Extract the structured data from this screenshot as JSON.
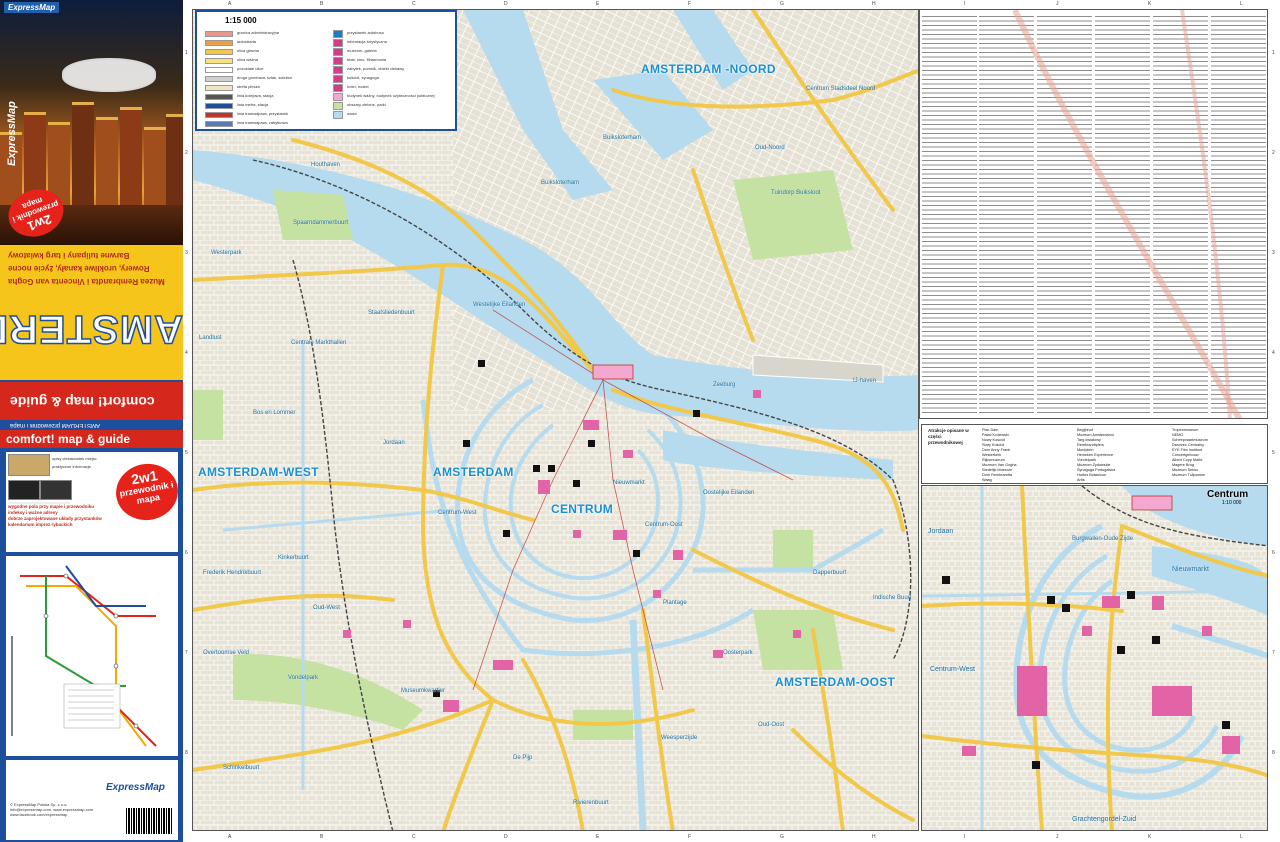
{
  "cover": {
    "brand": "ExpressMap",
    "title": "AMSTERDAM",
    "tagline": "comfort! map & guide",
    "subtitle": "AMSTERDAM   przewodnik i mapa",
    "bullets": [
      "Muzea Rembrandta i Vincenta van Gogha",
      "Rowery, urokliwe kanały, życie nocne",
      "Barwne tulipany i targ kwiatowy"
    ],
    "badge_main": "2w1",
    "badge_sub": "przewodnik i mapa",
    "features": [
      "opisy ciekawostek miejsc",
      "praktyczne informacje",
      "wygodne pola przy mapie i przewodniku",
      "indeksy i ważne adresy",
      "dobrze zaprojektowane układy przystanków",
      "kalendarium imprez rybackich"
    ],
    "publisher_lines": [
      "© ExpressMap Polska Sp. z o.o.",
      "info@expressmap.com, www.expressmap.com",
      "www.facebook.com/expressmap"
    ],
    "barcode": "9788375468"
  },
  "map": {
    "scale": "1:15 000",
    "grid_columns": [
      "A",
      "B",
      "C",
      "D",
      "E",
      "F",
      "G",
      "H",
      "I",
      "J",
      "K",
      "L"
    ],
    "grid_rows": [
      "1",
      "2",
      "3",
      "4",
      "5",
      "6",
      "7",
      "8"
    ],
    "districts": [
      {
        "label": "AMSTERDAM -NOORD"
      },
      {
        "label": "AMSTERDAM-WEST"
      },
      {
        "label": "AMSTERDAM"
      },
      {
        "label": "CENTRUM"
      },
      {
        "label": "AMSTERDAM-OOST"
      }
    ],
    "places": [
      "Buiksloterham",
      "Centrum Stadsdeel Noord",
      "Buiksloterham",
      "Oud-Noord",
      "Tuindorp Buiksloot",
      "Houthaven",
      "Spaarndammerbuurt",
      "Westerpark",
      "Staatsliedenbuurt",
      "Centrale Markthallen",
      "Landlust",
      "Bos en Lommer",
      "Centrum-West",
      "Centrum-Oost",
      "Kinkerbuurt",
      "Oud-West",
      "Vondelpark",
      "Museumkwartier",
      "De Pijp",
      "Weesperzijde",
      "Oud-Oost",
      "Nieuwmarkt",
      "Jordaan",
      "Westelijke Eilanden",
      "Oostelijke Eilanden",
      "Plantage",
      "Oosterpark",
      "Dapperbuurt",
      "Indische Buurt",
      "Rivierenbuurt",
      "IJ-haven",
      "Zeeburg",
      "Frederik Hendrikbuurt",
      "Overtoomse Veld",
      "Schinkelbuurt"
    ],
    "legend": [
      {
        "label": "granica administracyjna",
        "color": "#e89a8a"
      },
      {
        "label": "autostrada",
        "color": "#e8a040"
      },
      {
        "label": "ulica główna",
        "color": "#f1c84a"
      },
      {
        "label": "ulica ważna",
        "color": "#f7e27b"
      },
      {
        "label": "pozostałe ulice",
        "color": "#ffffff"
      },
      {
        "label": "droga gruntowa, szlak, ścieżka",
        "color": "#cfcfcf"
      },
      {
        "label": "strefa piesza",
        "color": "#f0e3c0"
      },
      {
        "label": "linia kolejowa, stacja",
        "color": "#555555"
      },
      {
        "label": "linia metra, stacja",
        "color": "#1d4f9c"
      },
      {
        "label": "linia tramwajowa, przystanek",
        "color": "#c0342a"
      },
      {
        "label": "linia tramwajowa, zabytkowa",
        "color": "#5a7bb7"
      },
      {
        "label": "przystanek autobusu",
        "color": "#1a7ec4"
      },
      {
        "label": "informacja turystyczna",
        "color": "#d33c88"
      },
      {
        "label": "muzeum, galeria",
        "color": "#d33c88"
      },
      {
        "label": "teatr, kino, filharmonia",
        "color": "#d33c88"
      },
      {
        "label": "zabytek, pomnik, obiekt ciekawy",
        "color": "#d33c88"
      },
      {
        "label": "kościół, synagoga",
        "color": "#d33c88"
      },
      {
        "label": "hotel, hostel",
        "color": "#d33c88"
      },
      {
        "label": "budynek ważny, budynek użyteczności publicznej",
        "color": "#f4a7cf"
      },
      {
        "label": "obszary zielone, parki",
        "color": "#c5e2a2"
      },
      {
        "label": "woda",
        "color": "#b6dbef"
      }
    ]
  },
  "sights": {
    "title": "Atrakcje opisane w części przewodnikowej",
    "items": [
      "Plac Dam",
      "Pałac Królewski",
      "Nowy Kościół",
      "Stary Kościół",
      "Dom Anny Frank",
      "Westerkerk",
      "Rijksmuseum",
      "Muzeum Van Gogha",
      "Stedelijk Museum",
      "Dom Rembrandta",
      "Waag",
      "Begijnhof",
      "Muzeum Amsterdamu",
      "Targ kwiatowy",
      "Rembrandtplein",
      "Muntplein",
      "Heineken Experience",
      "Vondelpark",
      "Muzeum Żydowskie",
      "Synagoga Portugalska",
      "Hortus Botanicus",
      "Artis",
      "Tropenmuseum",
      "NEMO",
      "Scheepvaartmuseum",
      "Dworzec Centralny",
      "EYE Film Instituut",
      "Concertgebouw",
      "Albert Cuyp Markt",
      "Magere Brug",
      "Muzeum Seksu",
      "Muzeum Tulipanów"
    ]
  },
  "inset": {
    "title": "Centrum",
    "scale": "1:10 000",
    "places": [
      "Jordaan",
      "Centrum-West",
      "Grachtengordel-Zuid",
      "Nieuwmarkt",
      "Burgwallen-Oude Zijde"
    ]
  },
  "colors": {
    "cover_blue": "#1d4f9c",
    "cover_yellow": "#f5c51b",
    "cover_red": "#d6271c",
    "water": "#b6dbef",
    "district_label": "#1b8fd0",
    "road_main": "#f1c84a",
    "park": "#c5e2a2",
    "tram": "#c0342a"
  }
}
